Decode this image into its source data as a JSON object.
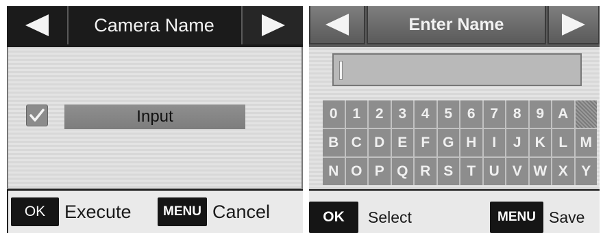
{
  "camera_name_screen": {
    "title": "Camera Name",
    "input_label": "Input",
    "ok_button": "OK",
    "ok_action": "Execute",
    "menu_button": "MENU",
    "menu_action": "Cancel"
  },
  "enter_name_screen": {
    "title": "Enter Name",
    "name_value": "",
    "keys": [
      "0",
      "1",
      "2",
      "3",
      "4",
      "5",
      "6",
      "7",
      "8",
      "9",
      "A",
      "",
      "B",
      "C",
      "D",
      "E",
      "F",
      "G",
      "H",
      "I",
      "J",
      "K",
      "L",
      "M",
      "N",
      "O",
      "P",
      "Q",
      "R",
      "S",
      "T",
      "U",
      "V",
      "W",
      "X",
      "Y"
    ],
    "ok_button": "OK",
    "ok_action": "Select",
    "menu_button": "MENU",
    "menu_action": "Save"
  },
  "icons": {
    "left": "left-arrow-icon",
    "right": "right-arrow-icon",
    "check": "check-icon"
  }
}
